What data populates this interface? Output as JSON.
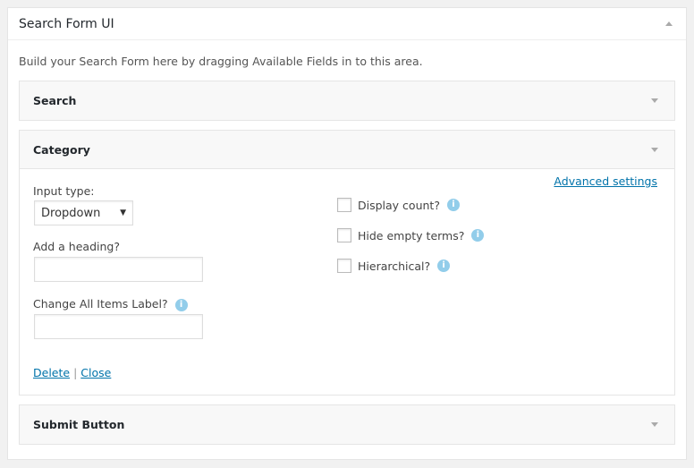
{
  "panel": {
    "title": "Search Form UI",
    "intro": "Build your Search Form here by dragging Available Fields in to this area."
  },
  "fields": {
    "search": {
      "title": "Search"
    },
    "category": {
      "title": "Category",
      "input_type_label": "Input type:",
      "input_type_value": "Dropdown",
      "heading_label": "Add a heading?",
      "heading_value": "",
      "all_items_label": "Change All Items Label?",
      "all_items_value": "",
      "advanced": "Advanced settings",
      "info": "i",
      "checkboxes": [
        {
          "label": "Display count?",
          "checked": false
        },
        {
          "label": "Hide empty terms?",
          "checked": false
        },
        {
          "label": "Hierarchical?",
          "checked": false
        }
      ],
      "delete": "Delete",
      "sep": "|",
      "close": "Close"
    },
    "submit": {
      "title": "Submit Button"
    }
  },
  "colors": {
    "link": "#0073aa",
    "info": "#92cdea"
  }
}
